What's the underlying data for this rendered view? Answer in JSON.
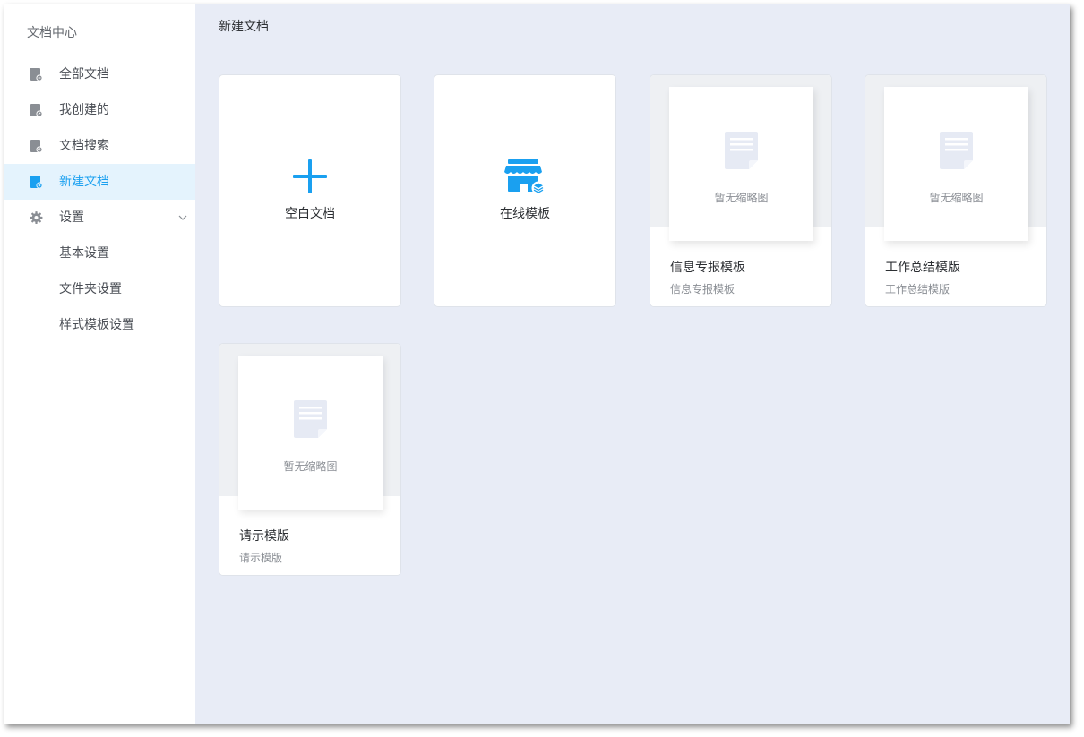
{
  "app": {
    "title": "文档中心"
  },
  "sidebar": {
    "items": [
      {
        "label": "全部文档",
        "icon": "doc-all-icon"
      },
      {
        "label": "我创建的",
        "icon": "doc-created-icon"
      },
      {
        "label": "文档搜索",
        "icon": "doc-search-icon"
      },
      {
        "label": "新建文档",
        "icon": "doc-new-icon",
        "active": true
      },
      {
        "label": "设置",
        "icon": "gear-icon",
        "expanded": true
      }
    ],
    "settings_children": [
      {
        "label": "基本设置"
      },
      {
        "label": "文件夹设置"
      },
      {
        "label": "样式模板设置"
      }
    ]
  },
  "main": {
    "title": "新建文档",
    "blank_card": {
      "label": "空白文档",
      "icon": "plus-icon"
    },
    "online_card": {
      "label": "在线模板",
      "icon": "store-icon"
    },
    "templates": [
      {
        "name": "信息专报模板",
        "desc": "信息专报模板",
        "thumb_text": "暂无缩略图"
      },
      {
        "name": "工作总结模版",
        "desc": "工作总结模版",
        "thumb_text": "暂无缩略图"
      },
      {
        "name": "请示模版",
        "desc": "请示模版",
        "thumb_text": "暂无缩略图"
      }
    ]
  },
  "colors": {
    "accent": "#1aa0f0",
    "active_bg": "#e4f3fd",
    "main_bg": "#e8ecf6",
    "icon_gray": "#8a8e94",
    "thumb_doc": "#e6eaf4"
  }
}
